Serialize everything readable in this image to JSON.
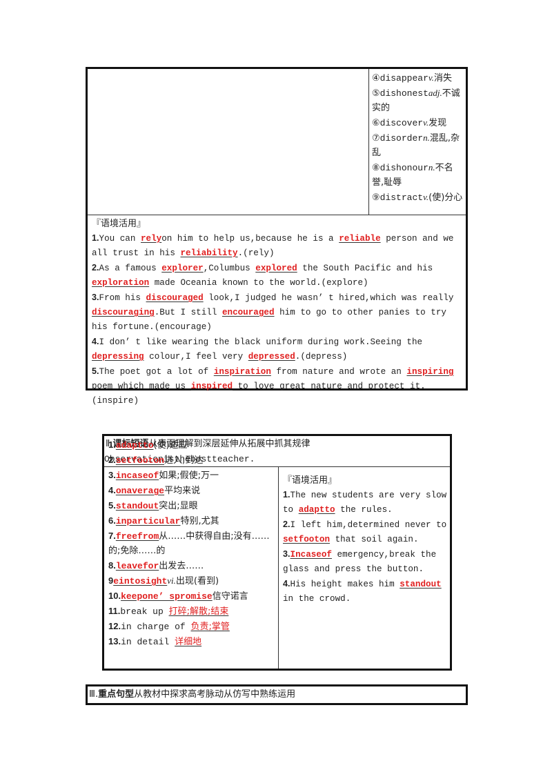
{
  "table1": {
    "vocab_list": [
      {
        "marker": "④",
        "word": "disappear",
        "pos": "v.",
        "meaning": "消失"
      },
      {
        "marker": "⑤",
        "word": "dishonest",
        "pos": "adj.",
        "meaning": "不诚实的"
      },
      {
        "marker": "⑥",
        "word": "discover",
        "pos": "v.",
        "meaning": "发现"
      },
      {
        "marker": "⑦",
        "word": "disorder",
        "pos": "n.",
        "meaning": "混乱,杂乱"
      },
      {
        "marker": "⑧",
        "word": "dishonour",
        "pos": "n.",
        "meaning": "不名誉,耻辱"
      },
      {
        "marker": "⑨",
        "word": "distract",
        "pos": "v.",
        "meaning": "(使)分心"
      }
    ],
    "context_header": "『语境活用』",
    "sentences": [
      {
        "num": "1.",
        "parts": [
          "You can ",
          "rely",
          "on him to help us,because he is a ",
          "reliable",
          " person and we all trust in his ",
          "reliability",
          ".(rely)"
        ]
      },
      {
        "num": "2.",
        "parts": [
          "As a famous ",
          "explorer",
          ",Columbus ",
          "explored",
          " the South Pacific and his ",
          "exploration",
          " made Oceania known to the world.(explore)"
        ]
      },
      {
        "num": "3.",
        "parts": [
          "From his ",
          "discouraged",
          " look,I judged he wasn’ t hired,which was really ",
          "discouraging",
          ".But I still ",
          "encouraged",
          " him to go to other panies to try his fortune.(encourage)"
        ]
      },
      {
        "num": "4.",
        "parts": [
          "I don’ t like wearing the black uniform during work.Seeing the ",
          "depressing",
          " colour,I feel very ",
          "depressed",
          ".(depress)"
        ]
      },
      {
        "num": "5.",
        "parts": [
          "The poet got a lot of ",
          "inspiration",
          " from nature and wrote an ",
          "inspiring",
          " poem which made us ",
          "inspired",
          " to love great nature and protect it.(inspire)"
        ]
      }
    ]
  },
  "table2": {
    "section_numeral": "Ⅱ.",
    "section_title": "课标短语",
    "section_subtitle": "从表面理解到深层延伸从拓展中抓其规律",
    "motto": "Observationisthebestteacher.",
    "phrases": [
      {
        "num": "1.",
        "answer": "adaptto",
        "meaning": "(使)适应"
      },
      {
        "num": "2.",
        "answer": "setfooton",
        "meaning": "进入;到达"
      },
      {
        "num": "3.",
        "answer": "incaseof",
        "meaning": "如果;假使;万一"
      },
      {
        "num": "4.",
        "answer": "onaverage",
        "meaning": "平均来说"
      },
      {
        "num": "5.",
        "answer": "standout",
        "meaning": "突出;显眼"
      },
      {
        "num": "6.",
        "answer": "inparticular",
        "meaning": "特别,尤其"
      },
      {
        "num": "7.",
        "answer": "freefrom",
        "meaning": "从……中获得自由;没有……的;免除……的"
      },
      {
        "num": "8.",
        "answer": "leavefor",
        "meaning": "出发去……"
      },
      {
        "num": "9",
        "answer": "eintosight",
        "meaning": "vi.出现(看到)"
      },
      {
        "num": "10.",
        "answer": "keepone’ spromise",
        "meaning": "信守诺言"
      }
    ],
    "phrases_reverse": [
      {
        "num": "11.",
        "phrase": "break up",
        "answer": "打碎;解散;结束"
      },
      {
        "num": "12.",
        "phrase": "in charge of",
        "answer": "负责;掌管"
      },
      {
        "num": "13.",
        "phrase": "in detail",
        "answer": "详细地"
      }
    ],
    "context_header": "『语境活用』",
    "sentences": [
      {
        "num": "1.",
        "parts": [
          "The new students are very slow to ",
          "adaptto",
          " the rules."
        ]
      },
      {
        "num": "2.",
        "parts": [
          "I left him,determined never to ",
          "setfooton",
          " that soil again."
        ]
      },
      {
        "num": "3.",
        "parts": [
          "",
          "Incaseof",
          " emergency,break the glass and press the button."
        ]
      },
      {
        "num": "4.",
        "parts": [
          "His height makes him ",
          "standout",
          " in the crowd."
        ]
      }
    ]
  },
  "section3": {
    "numeral": "Ⅲ.",
    "title": "重点句型",
    "subtitle": "从教材中探求高考脉动从仿写中熟练运用"
  },
  "colors": {
    "answer_red": "#e02020",
    "border": "#111111",
    "text": "#222222"
  }
}
